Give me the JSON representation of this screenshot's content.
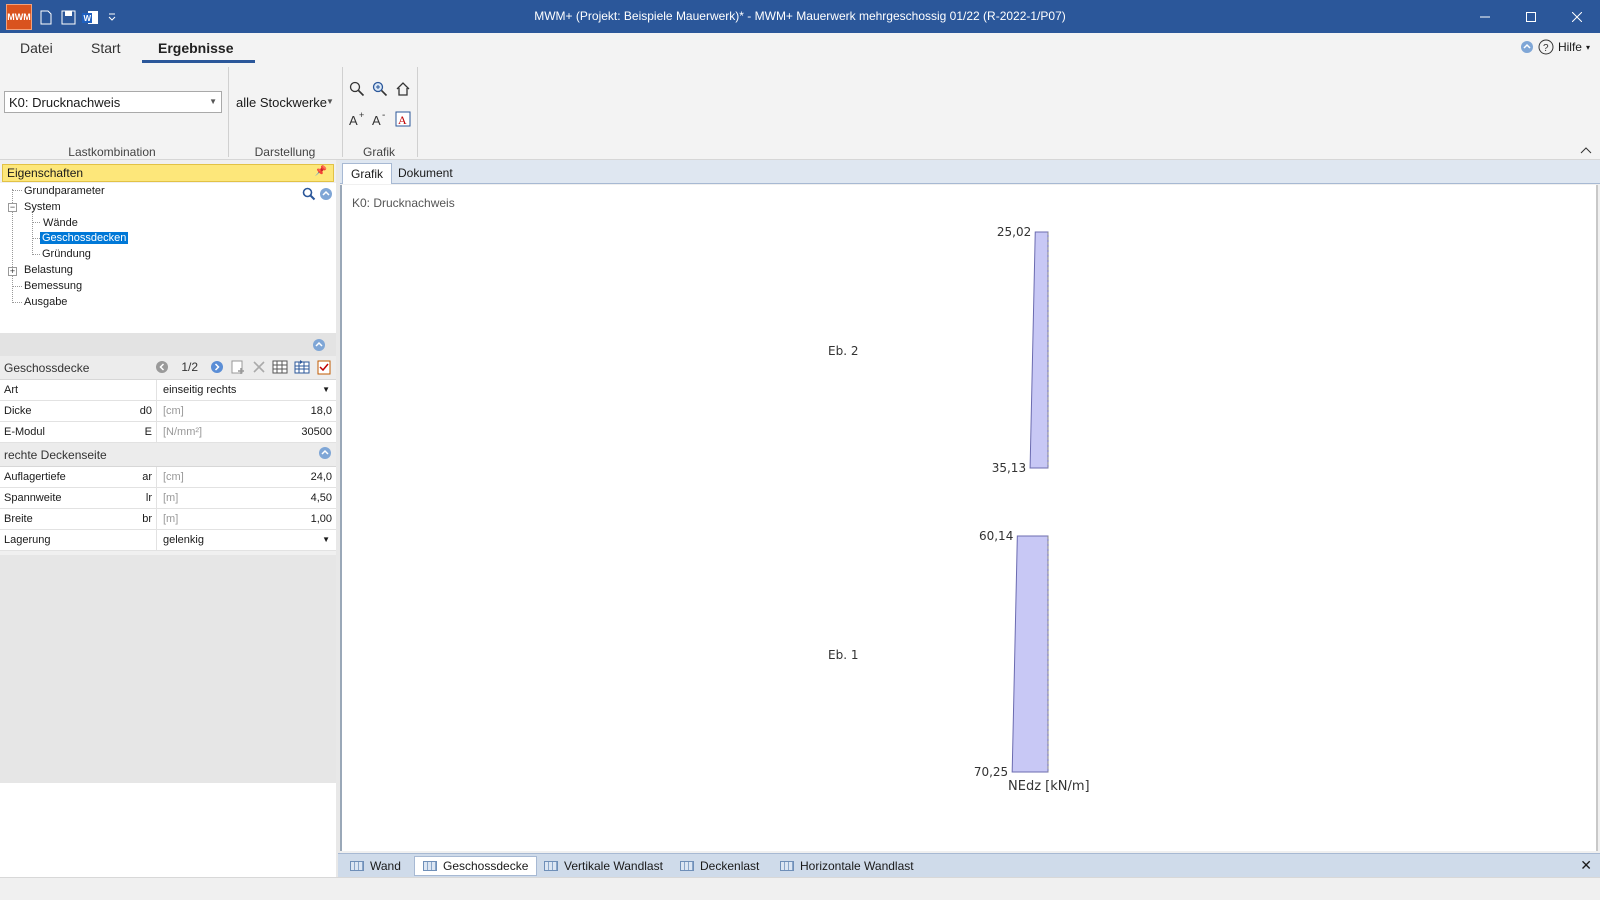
{
  "window": {
    "title": "MWM+ (Projekt: Beispiele Mauerwerk)* - MWM+ Mauerwerk mehrgeschossig 01/22 (R-2022-1/P07)",
    "logo_text": "MWM"
  },
  "menu": {
    "tabs": [
      "Datei",
      "Start",
      "Ergebnisse"
    ],
    "active": "Ergebnisse",
    "help_label": "Hilfe"
  },
  "ribbon": {
    "lastkombination": {
      "value": "K0: Drucknachweis",
      "group_label": "Lastkombination"
    },
    "darstellung": {
      "value": "alle Stockwerke",
      "group_label": "Darstellung"
    },
    "grafik": {
      "group_label": "Grafik"
    }
  },
  "properties": {
    "header": "Eigenschaften",
    "tree": {
      "grundparameter": "Grundparameter",
      "system": "System",
      "waende": "Wände",
      "geschossdecken": "Geschossdecken",
      "gruendung": "Gründung",
      "belastung": "Belastung",
      "bemessung": "Bemessung",
      "ausgabe": "Ausgabe"
    },
    "section1": {
      "title": "Geschossdecke",
      "pager": "1/2",
      "rows": {
        "art": {
          "name": "Art",
          "value": "einseitig rechts"
        },
        "dicke": {
          "name": "Dicke",
          "symbol": "d0",
          "unit": "[cm]",
          "value": "18,0"
        },
        "emodul": {
          "name": "E-Modul",
          "symbol": "E",
          "unit": "[N/mm²]",
          "value": "30500"
        }
      }
    },
    "section2": {
      "title": "rechte Deckenseite",
      "rows": {
        "auflagertiefe": {
          "name": "Auflagertiefe",
          "symbol": "ar",
          "unit": "[cm]",
          "value": "24,0"
        },
        "spannweite": {
          "name": "Spannweite",
          "symbol": "lr",
          "unit": "[m]",
          "value": "4,50"
        },
        "breite": {
          "name": "Breite",
          "symbol": "br",
          "unit": "[m]",
          "value": "1,00"
        },
        "lagerung": {
          "name": "Lagerung",
          "value": "gelenkig"
        }
      }
    }
  },
  "content": {
    "tabs": [
      "Grafik",
      "Dokument"
    ],
    "active": "Grafik",
    "canvas_title": "K0: Drucknachweis"
  },
  "chart_data": {
    "type": "bar",
    "xlabel": "NEdz [kN/m]",
    "levels": [
      {
        "name": "Eb. 2",
        "top_label": "25,02",
        "bottom_label": "35,13",
        "top": 25.02,
        "bottom": 35.13
      },
      {
        "name": "Eb. 1",
        "top_label": "60,14",
        "bottom_label": "70,25",
        "top": 60.14,
        "bottom": 70.25
      }
    ],
    "fill_color": "#c8c8f5",
    "stroke_color": "#6b6bb0"
  },
  "bottom_tabs": {
    "items": [
      "Wand",
      "Geschossdecke",
      "Vertikale Wandlast",
      "Deckenlast",
      "Horizontale Wandlast"
    ],
    "active": "Geschossdecke"
  }
}
